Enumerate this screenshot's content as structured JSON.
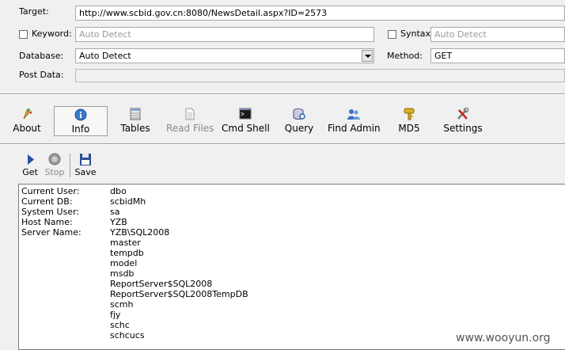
{
  "form": {
    "target_label": "Target:",
    "target_value": "http://www.scbid.gov.cn:8080/NewsDetail.aspx?ID=2573",
    "keyword_label": "Keyword:",
    "keyword_placeholder": "Auto Detect",
    "syntax_label": "Syntax:",
    "syntax_placeholder": "Auto Detect",
    "database_label": "Database:",
    "database_value": "Auto Detect",
    "method_label": "Method:",
    "method_value": "GET",
    "postdata_label": "Post Data:"
  },
  "toolbar": [
    {
      "label": "About",
      "icon": "about-icon",
      "selected": false,
      "disabled": false
    },
    {
      "label": "Info",
      "icon": "info-icon",
      "selected": true,
      "disabled": false
    },
    {
      "label": "Tables",
      "icon": "tables-icon",
      "selected": false,
      "disabled": false
    },
    {
      "label": "Read Files",
      "icon": "read-files-icon",
      "selected": false,
      "disabled": true
    },
    {
      "label": "Cmd Shell",
      "icon": "cmd-shell-icon",
      "selected": false,
      "disabled": false
    },
    {
      "label": "Query",
      "icon": "query-icon",
      "selected": false,
      "disabled": false
    },
    {
      "label": "Find Admin",
      "icon": "find-admin-icon",
      "selected": false,
      "disabled": false
    },
    {
      "label": "MD5",
      "icon": "md5-key-icon",
      "selected": false,
      "disabled": false
    },
    {
      "label": "Settings",
      "icon": "settings-icon",
      "selected": false,
      "disabled": false
    }
  ],
  "actions": {
    "get_label": "Get",
    "stop_label": "Stop",
    "save_label": "Save"
  },
  "output": {
    "fields": [
      {
        "key": "Current User:",
        "value": "dbo"
      },
      {
        "key": "Current DB:",
        "value": "scbidMh"
      },
      {
        "key": "System User:",
        "value": "sa"
      },
      {
        "key": "Host Name:",
        "value": "YZB"
      },
      {
        "key": "Server Name:",
        "value": "YZB\\SQL2008"
      }
    ],
    "databases": [
      "master",
      "tempdb",
      "model",
      "msdb",
      "ReportServer$SQL2008",
      "ReportServer$SQL2008TempDB",
      "scmh",
      "fjy",
      "schc",
      "schcucs"
    ]
  },
  "watermark": "www.wooyun.org",
  "colors": {
    "window_bg": "#f0f0f0",
    "info_icon": "#3a78c8",
    "get_icon": "#2050a8",
    "save_icon": "#2a4f9a",
    "md5_key": "#d8b020",
    "settings_red": "#c82020"
  }
}
